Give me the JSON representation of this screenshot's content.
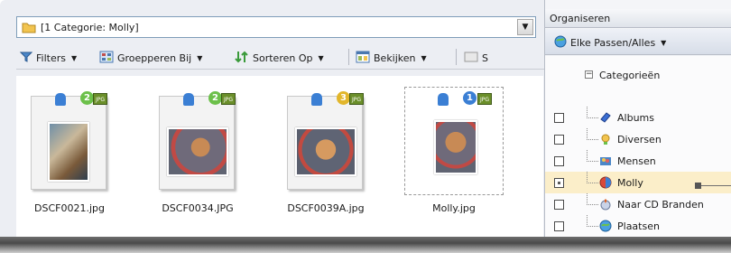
{
  "address_bar": {
    "text": "[1 Categorie: Molly]"
  },
  "toolbar": {
    "filters": "Filters",
    "group_by": "Groepperen Bij",
    "sort_by": "Sorteren Op",
    "view": "Bekijken",
    "cut_label": "S"
  },
  "thumbnails": [
    {
      "filename": "DSCF0021.jpg",
      "badge": "2",
      "badge_color": "#6cc04a",
      "format": "JPG",
      "orientation": "portrait"
    },
    {
      "filename": "DSCF0034.JPG",
      "badge": "2",
      "badge_color": "#6cc04a",
      "format": "JPG",
      "orientation": "landscape"
    },
    {
      "filename": "DSCF0039A.jpg",
      "badge": "3",
      "badge_color": "#e2b62b",
      "format": "JPG",
      "orientation": "landscape"
    },
    {
      "filename": "Molly.jpg",
      "badge": "1",
      "badge_color": "#3b7fd4",
      "format": "JPG",
      "orientation": "portrait"
    }
  ],
  "organize_panel": {
    "title": "Organiseren",
    "match_dropdown": "Elke Passen/Alles",
    "categories_header": "Categorieën",
    "categories": [
      {
        "label": "Albums",
        "icon": "albums-icon",
        "checked": false,
        "selected": false
      },
      {
        "label": "Diversen",
        "icon": "diversen-icon",
        "checked": false,
        "selected": false
      },
      {
        "label": "Mensen",
        "icon": "people-icon",
        "checked": false,
        "selected": false
      },
      {
        "label": "Molly",
        "icon": "molly-category-icon",
        "checked": "mixed",
        "selected": true
      },
      {
        "label": "Naar CD Branden",
        "icon": "burn-cd-icon",
        "checked": false,
        "selected": false
      },
      {
        "label": "Plaatsen",
        "icon": "places-icon",
        "checked": false,
        "selected": false
      }
    ]
  },
  "colors": {
    "selection_highlight": "#fbeec9",
    "accent_blue": "#3b7fd4"
  }
}
